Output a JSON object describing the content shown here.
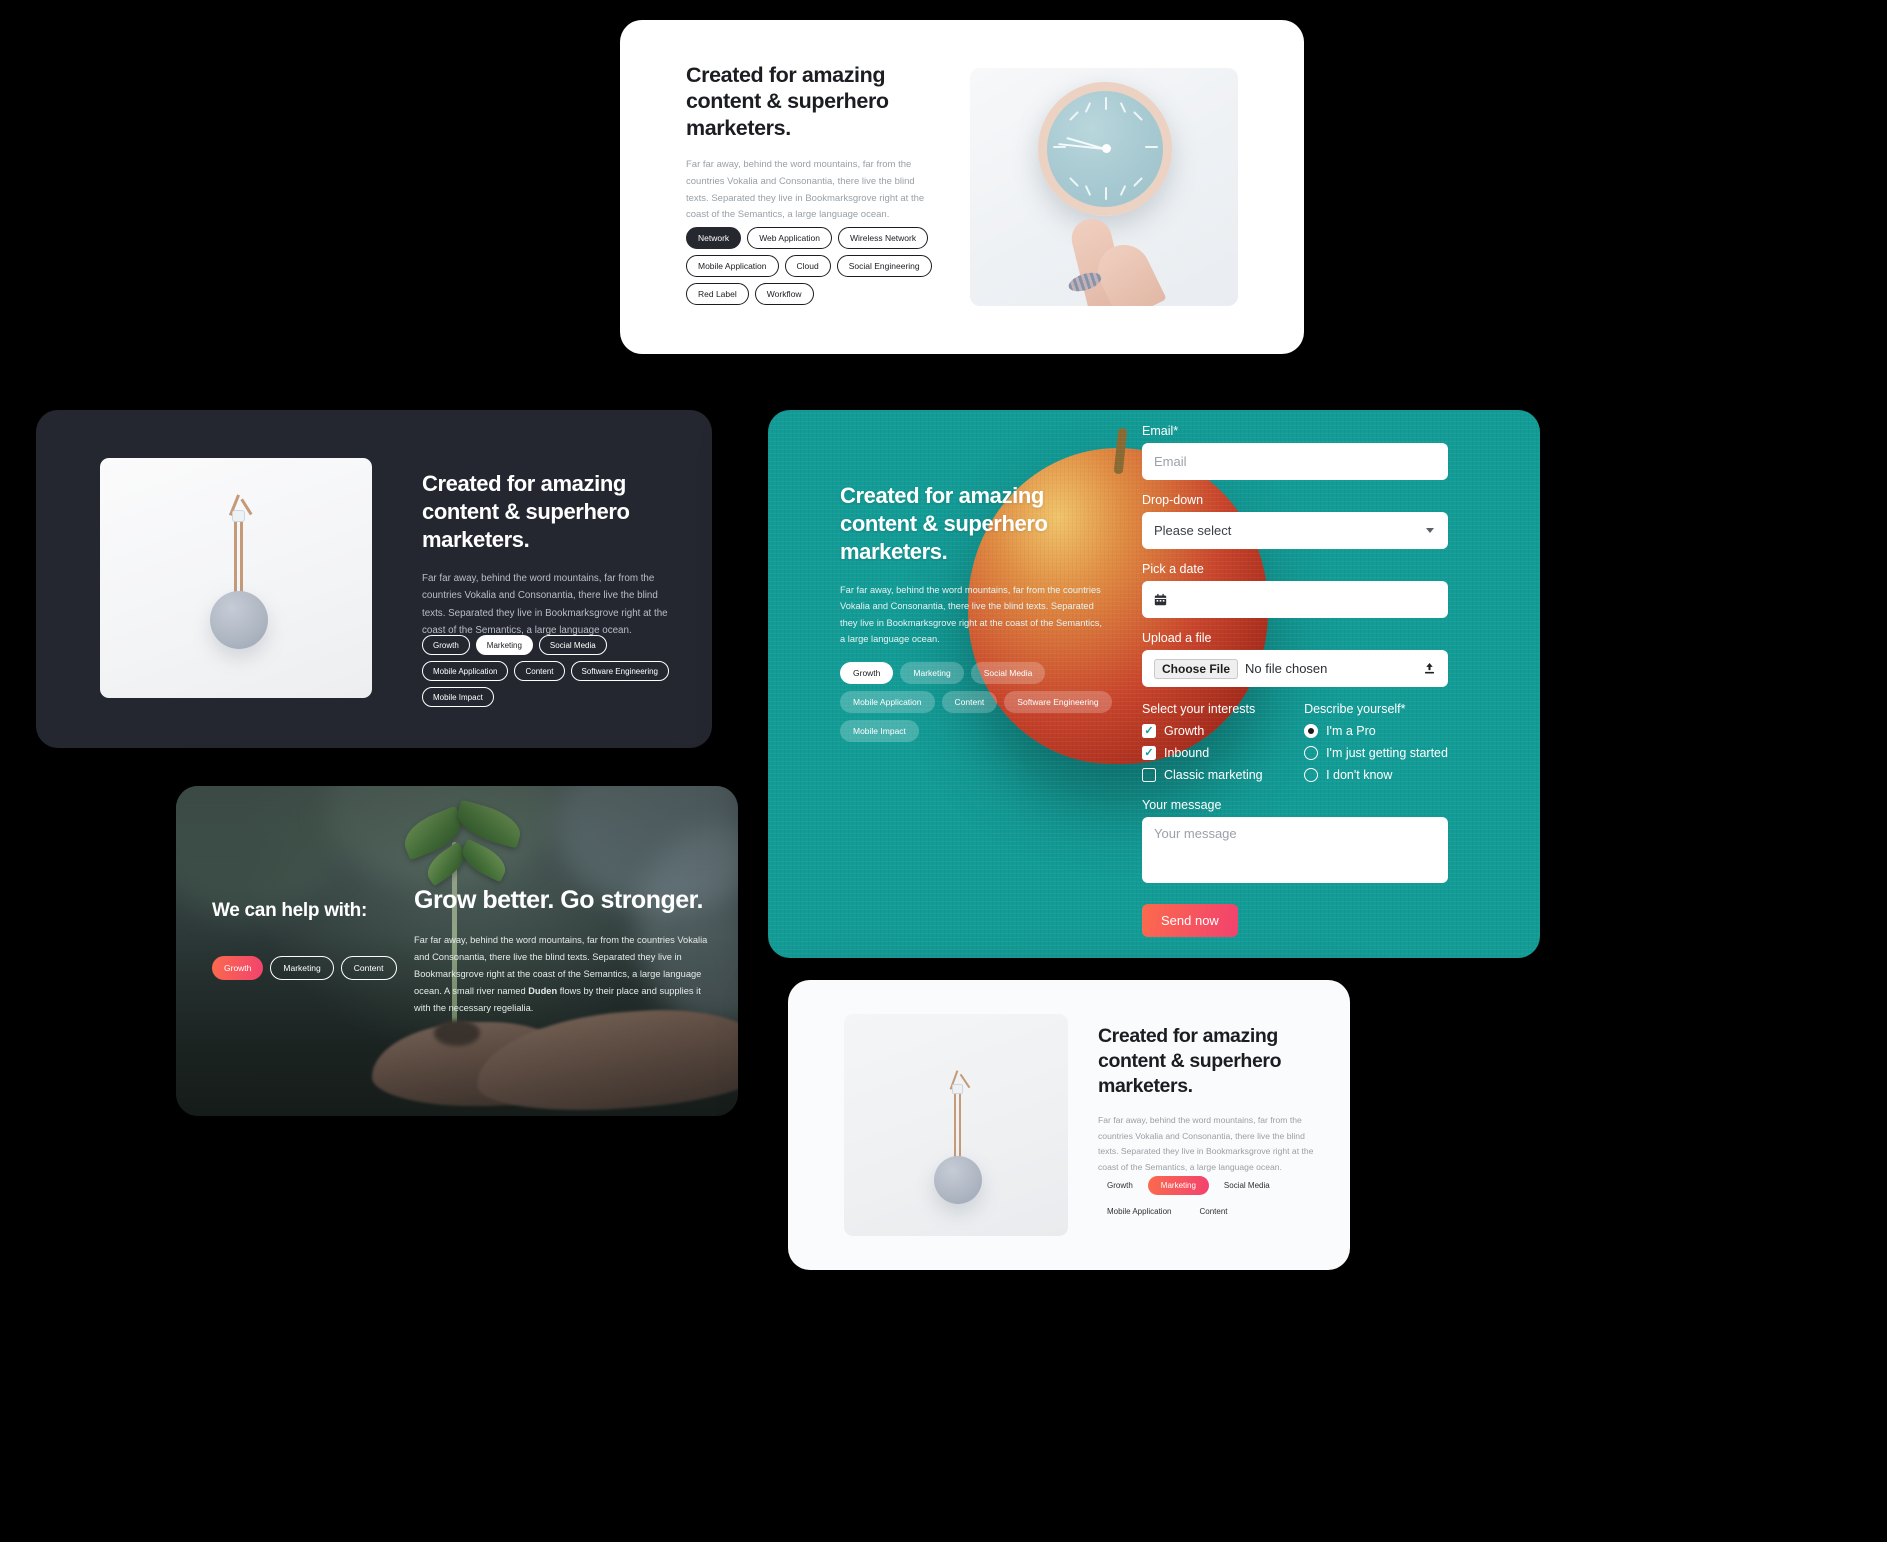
{
  "colors": {
    "background": "#000000",
    "dark_card": "#242730",
    "teal_card": "#139b96",
    "accent_red_start": "#fb6a4d",
    "accent_red_end": "#f2426e",
    "white": "#ffffff"
  },
  "shared": {
    "heading": "Created for amazing content & superhero marketers.",
    "heading_lines": [
      "Created for amazing",
      "content & superhero",
      "marketers."
    ],
    "body": "Far far away, behind the word mountains, far from the countries Vokalia and Consonantia, there live the blind texts. Separated they live in Bookmarksgrove right at the coast of the Semantics, a large language ocean."
  },
  "card_clock": {
    "heading_lines": [
      "Created for amazing",
      "content & superhero",
      "marketers."
    ],
    "body": "Far far away, behind the word mountains, far from the countries Vokalia and Consonantia, there live the blind texts. Separated they live in Bookmarksgrove right at the coast of the Semantics, a large language ocean.",
    "image_alt": "wall-clock-held-by-hand-photo",
    "tags": [
      {
        "label": "Network",
        "active": true
      },
      {
        "label": "Web Application",
        "active": false
      },
      {
        "label": "Wireless Network",
        "active": false
      },
      {
        "label": "Mobile Application",
        "active": false
      },
      {
        "label": "Cloud",
        "active": false
      },
      {
        "label": "Social Engineering",
        "active": false
      },
      {
        "label": "Red Label",
        "active": false
      },
      {
        "label": "Workflow",
        "active": false
      }
    ]
  },
  "card_dark": {
    "heading_lines": [
      "Created for amazing",
      "content & superhero",
      "marketers."
    ],
    "body": "Far far away, behind the word mountains, far from the countries Vokalia and Consonantia, there live the blind texts. Separated they live in Bookmarksgrove right at the coast of the Semantics, a large language ocean.",
    "image_alt": "hanging-pendant-speaker-photo",
    "tags": [
      {
        "label": "Growth",
        "active": false
      },
      {
        "label": "Marketing",
        "active": true
      },
      {
        "label": "Social Media",
        "active": false
      },
      {
        "label": "Mobile Application",
        "active": false
      },
      {
        "label": "Content",
        "active": false
      },
      {
        "label": "Software Engineering",
        "active": false
      },
      {
        "label": "Mobile Impact",
        "active": false
      }
    ]
  },
  "card_nature": {
    "kicker": "We can help with:",
    "heading": "Grow better. Go stronger.",
    "body_before": "Far far away, behind the word mountains, far from the countries Vokalia and Consonantia, there live the blind texts. Separated they live in Bookmarksgrove right at the coast of the Semantics, a large language ocean. A small river named ",
    "body_bold": "Duden",
    "body_after": " flows by their place and supplies it with the necessary regelialia.",
    "image_alt": "hands-holding-seedling-photo",
    "tags": [
      {
        "label": "Growth",
        "active": true
      },
      {
        "label": "Marketing",
        "active": false
      },
      {
        "label": "Content",
        "active": false
      }
    ]
  },
  "card_form": {
    "heading_lines": [
      "Created for amazing",
      "content & superhero",
      "marketers."
    ],
    "body": "Far far away, behind the word mountains, far from the countries Vokalia and Consonantia, there live the blind texts. Separated they live in Bookmarksgrove right at the coast of the Semantics, a large language ocean.",
    "image_alt": "red-apple-photo",
    "tags": [
      {
        "label": "Growth",
        "active": true
      },
      {
        "label": "Marketing",
        "active": false
      },
      {
        "label": "Social Media",
        "active": false
      },
      {
        "label": "Mobile Application",
        "active": false
      },
      {
        "label": "Content",
        "active": false
      },
      {
        "label": "Software Engineering",
        "active": false
      },
      {
        "label": "Mobile Impact",
        "active": false
      }
    ],
    "fields": {
      "email_label": "Email*",
      "email_placeholder": "Email",
      "email_value": "",
      "dropdown_label": "Drop-down",
      "dropdown_value": "Please select",
      "date_label": "Pick a date",
      "date_value": "",
      "upload_label": "Upload a file",
      "upload_button": "Choose File",
      "upload_status": "No file chosen",
      "message_label": "Your message",
      "message_placeholder": "Your message",
      "message_value": "",
      "submit_label": "Send now"
    },
    "interests": {
      "legend": "Select your interests",
      "options": [
        {
          "label": "Growth",
          "checked": true
        },
        {
          "label": "Inbound",
          "checked": true
        },
        {
          "label": "Classic marketing",
          "checked": false
        }
      ]
    },
    "describe": {
      "legend": "Describe yourself*",
      "options": [
        {
          "label": "I'm a Pro",
          "selected": true
        },
        {
          "label": "I'm just getting started",
          "selected": false
        },
        {
          "label": "I don't know",
          "selected": false
        }
      ]
    }
  },
  "card_light": {
    "heading_lines": [
      "Created for amazing",
      "content & superhero",
      "marketers."
    ],
    "body": "Far far away, behind the word mountains, far from the countries Vokalia and Consonantia, there live the blind texts. Separated they live in Bookmarksgrove right at the coast of the Semantics, a large language ocean.",
    "image_alt": "hanging-pendant-speaker-photo",
    "tags": [
      {
        "label": "Growth",
        "active": false
      },
      {
        "label": "Marketing",
        "active": true
      },
      {
        "label": "Social Media",
        "active": false
      },
      {
        "label": "Mobile Application",
        "active": false
      },
      {
        "label": "Content",
        "active": false
      }
    ]
  }
}
